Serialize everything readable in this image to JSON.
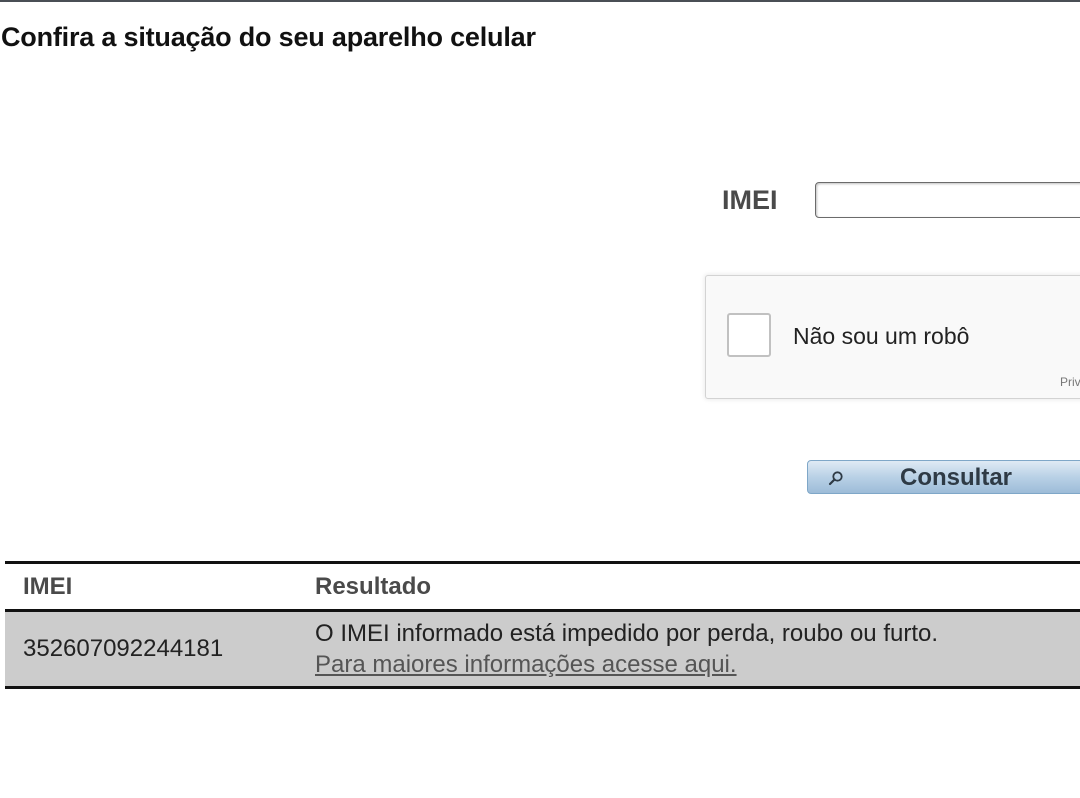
{
  "page": {
    "title": "Confira a situação do seu aparelho celular"
  },
  "form": {
    "imei_label": "IMEI",
    "imei_value": "",
    "recaptcha_label": "Não sou um robô",
    "recaptcha_privacy_fragment": "Priv",
    "submit_label": "Consultar",
    "submit_icon": "search-icon"
  },
  "results": {
    "headers": {
      "imei": "IMEI",
      "result": "Resultado"
    },
    "rows": [
      {
        "imei": "352607092244181",
        "message": "O IMEI informado está impedido por perda, roubo ou furto.",
        "link_text": "Para maiores informações acesse aqui."
      }
    ]
  },
  "colors": {
    "result_row_bg": "#cccccc",
    "button_gradient_mid": "#b9d1e6",
    "label_text": "#4a4a4a"
  }
}
